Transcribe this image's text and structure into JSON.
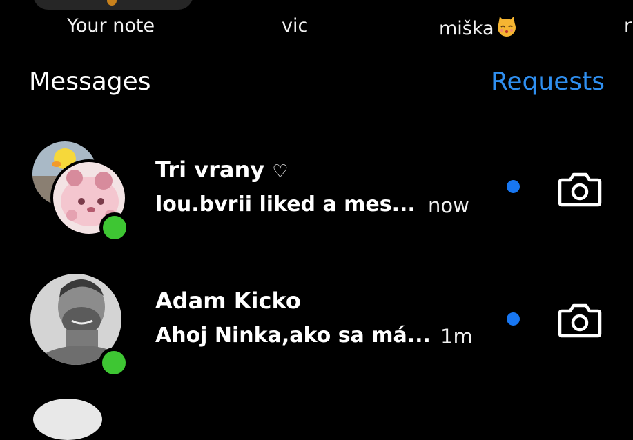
{
  "notes": {
    "items": [
      {
        "label": "Your note"
      },
      {
        "label": "vic"
      },
      {
        "label": "miška",
        "emoji": "kissing-cat-face"
      },
      {
        "label": "r"
      }
    ]
  },
  "header": {
    "title": "Messages",
    "requests_label": "Requests"
  },
  "threads": [
    {
      "name": "Tri vrany",
      "name_suffix": "♡",
      "preview": "lou.bvrii liked a mes...",
      "time": "now",
      "unread": true,
      "online": true
    },
    {
      "name": "Adam Kicko",
      "preview": "Ahoj Ninka,ako sa má...",
      "time": "1m",
      "unread": true,
      "online": true
    }
  ],
  "colors": {
    "background": "#000000",
    "accent": "#2f8ff0",
    "unread_dot": "#1877f2",
    "online": "#3ec633"
  }
}
